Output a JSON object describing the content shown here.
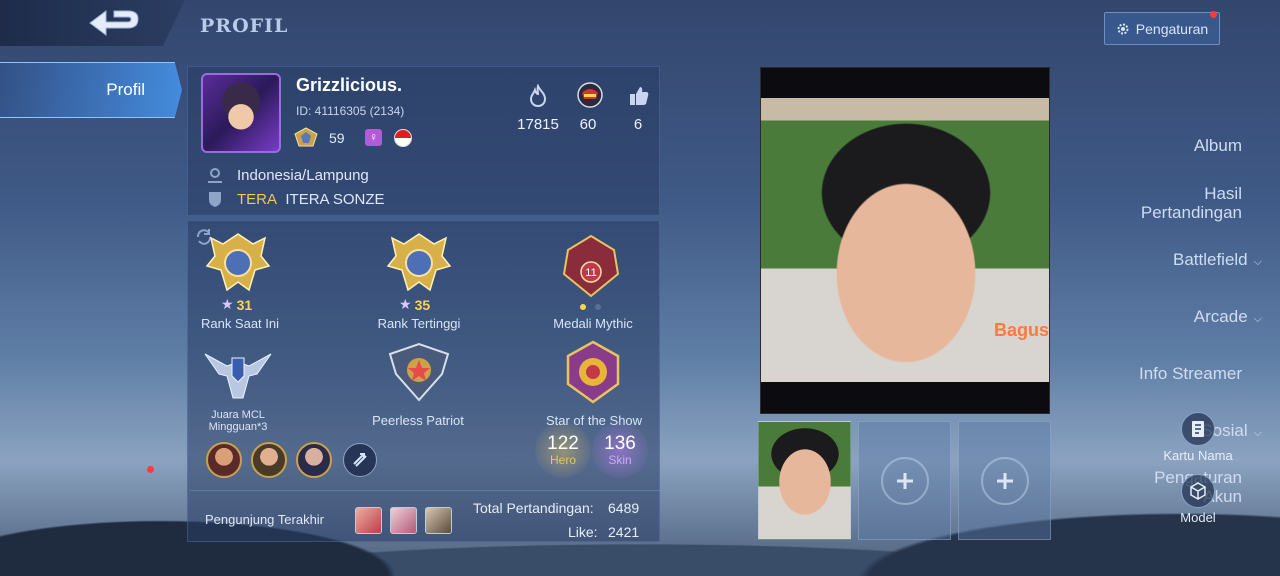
{
  "header": {
    "title": "PROFIL",
    "settings_label": "Pengaturan"
  },
  "sidebar": {
    "items": [
      {
        "label": "Profil"
      },
      {
        "label": "Album"
      },
      {
        "label": "Hasil"
      },
      {
        "label": "Pertandingan"
      },
      {
        "label": "Battlefield"
      },
      {
        "label": "Arcade"
      },
      {
        "label": "Info Streamer"
      },
      {
        "label": "Sosial"
      },
      {
        "label": "Pengaturan"
      },
      {
        "label": "Akun"
      }
    ]
  },
  "profile": {
    "name": "Grizzlicious.",
    "id": "ID: 41116305 (2134)",
    "level": "59",
    "stats": [
      {
        "icon": "flame-icon",
        "value": "17815"
      },
      {
        "icon": "helmet-icon",
        "value": "60"
      },
      {
        "icon": "thumbs-up-icon",
        "value": "6"
      }
    ],
    "location": "Indonesia/Lampung",
    "squad_tag": "TERA",
    "squad_name": "ITERA SONZE"
  },
  "ranks": {
    "current": {
      "stars": "31",
      "label": "Rank Saat Ini"
    },
    "highest": {
      "stars": "35",
      "label": "Rank Tertinggi"
    },
    "mythic": {
      "level": "11",
      "label": "Medali Mythic"
    },
    "mcl": {
      "label_line1": "Juara MCL",
      "label_line2": "Mingguan*3"
    },
    "peerless": {
      "label": "Peerless Patriot"
    },
    "star_show": {
      "label": "Star of the Show"
    }
  },
  "counts": {
    "hero": {
      "value": "122",
      "label": "Hero"
    },
    "skin": {
      "value": "136",
      "label": "Skin"
    }
  },
  "visitors_label": "Pengunjung Terakhir",
  "totals": {
    "matches_label": "Total Pertandingan:",
    "matches_value": "6489",
    "like_label": "Like:",
    "like_value": "2421"
  },
  "photo": {
    "watermark": "Bagus"
  },
  "right_actions": {
    "name_card": "Kartu Nama",
    "model": "Model"
  },
  "colors": {
    "accent_blue": "#4a96f0",
    "squad_gold": "#f2c94c",
    "notification_red": "#ff3b3b",
    "skin_purple": "#b07ae8",
    "hero_gold": "#e8c55c"
  }
}
